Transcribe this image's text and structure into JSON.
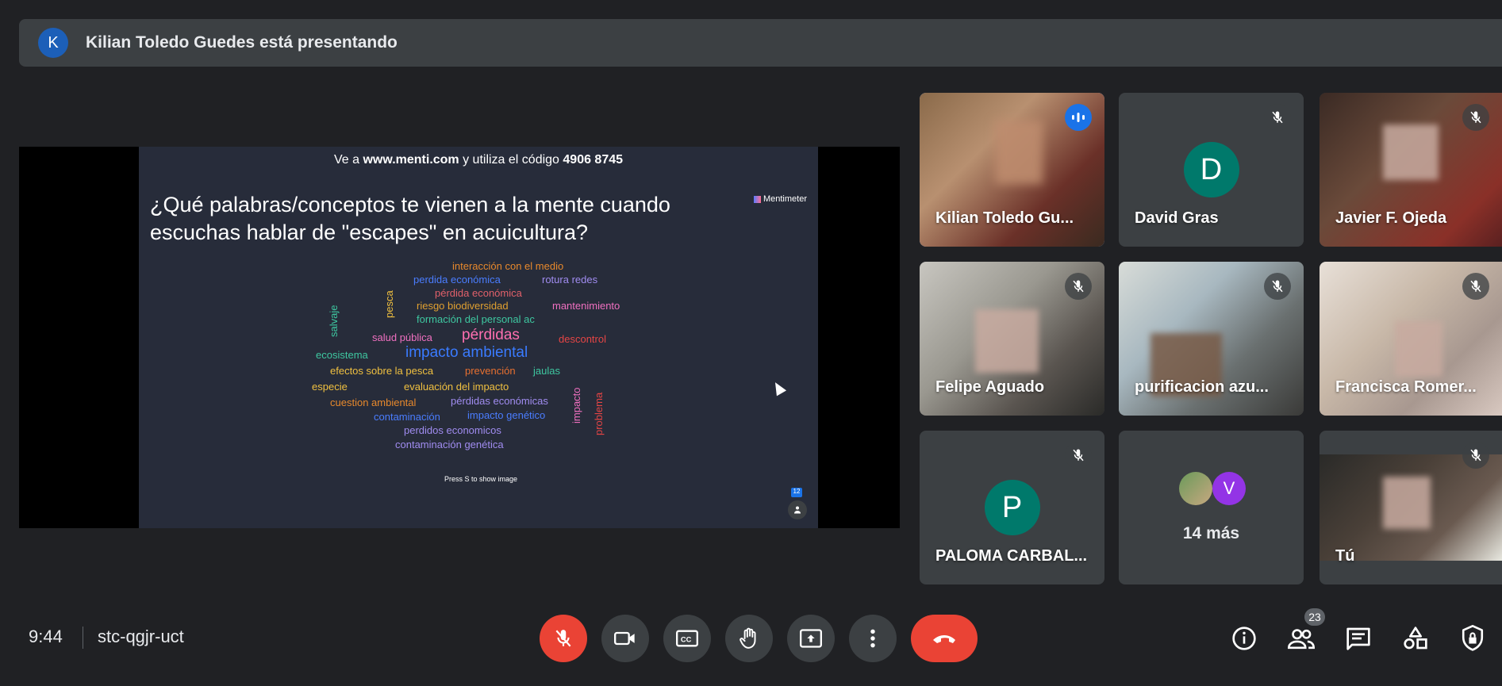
{
  "presenter": {
    "avatar_letter": "K",
    "text": "Kilian Toledo Guedes está presentando"
  },
  "slide": {
    "code_prefix": "Ve a ",
    "code_site": "www.menti.com",
    "code_middle": " y utiliza el código ",
    "code_number": "4906 8745",
    "question": "¿Qué palabras/conceptos te vienen a la mente cuando escuchas hablar de \"escapes\" en acuicultura?",
    "logo": "Mentimeter",
    "press_hint": "Press S to show image",
    "respondent_count": "12",
    "words": [
      "interacción con el medio",
      "perdida económica",
      "rotura redes",
      "pérdida económica",
      "riesgo biodiversidad",
      "mantenimiento",
      "formación del personal ac",
      "salud pública",
      "pérdidas",
      "descontrol",
      "ecosistema",
      "impacto ambiental",
      "efectos sobre la pesca",
      "prevención",
      "jaulas",
      "especie",
      "evaluación del impacto",
      "cuestion ambiental",
      "pérdidas económicas",
      "contaminación",
      "impacto genético",
      "perdidos economicos",
      "contaminación genética",
      "pesca",
      "salvaje",
      "impacto",
      "problema"
    ],
    "word_colors": [
      "#e8892c",
      "#4a7dff",
      "#a08cf0",
      "#e0606a",
      "#e0a030",
      "#f070c0",
      "#3ec7a0",
      "#f070c0",
      "#ff6fb0",
      "#e54545",
      "#3ec7a0",
      "#3a7bff",
      "#f0c040",
      "#e87030",
      "#3ec7a0",
      "#f0c040",
      "#f0c040",
      "#e8892c",
      "#a08cf0",
      "#4a7dff",
      "#4a7dff",
      "#a08cf0",
      "#a08cf0",
      "#f0c040",
      "#3ec7a0",
      "#f070c0",
      "#e54545"
    ]
  },
  "participants": [
    {
      "name": "Kilian Toledo Gu...",
      "mic": "speaking",
      "type": "video"
    },
    {
      "name": "David Gras",
      "mic": "muted",
      "type": "letter",
      "letter": "D",
      "color": "#00796b"
    },
    {
      "name": "Javier F. Ojeda",
      "mic": "muted",
      "type": "video"
    },
    {
      "name": "Felipe Aguado",
      "mic": "muted",
      "type": "video"
    },
    {
      "name": "purificacion azu...",
      "mic": "muted",
      "type": "video"
    },
    {
      "name": "Francisca Romer...",
      "mic": "muted",
      "type": "video"
    },
    {
      "name": "PALOMA CARBAL...",
      "mic": "muted",
      "type": "letter",
      "letter": "P",
      "color": "#00796b"
    },
    {
      "name": "14 más",
      "type": "overflow",
      "letter": "V",
      "color": "#9334e6"
    },
    {
      "name": "Tú",
      "mic": "muted",
      "type": "video"
    }
  ],
  "meeting": {
    "time": "9:44",
    "code": "stc-qgjr-uct",
    "people_count": "23"
  },
  "icons": {
    "mic": "mic-off-icon",
    "camera": "videocam-icon",
    "captions": "closed-caption-icon",
    "hand": "raise-hand-icon",
    "present": "present-screen-icon",
    "more": "more-vert-icon",
    "hangup": "call-end-icon",
    "info": "info-icon",
    "people": "people-icon",
    "chat": "chat-icon",
    "activities": "activities-icon",
    "host": "host-controls-icon"
  }
}
